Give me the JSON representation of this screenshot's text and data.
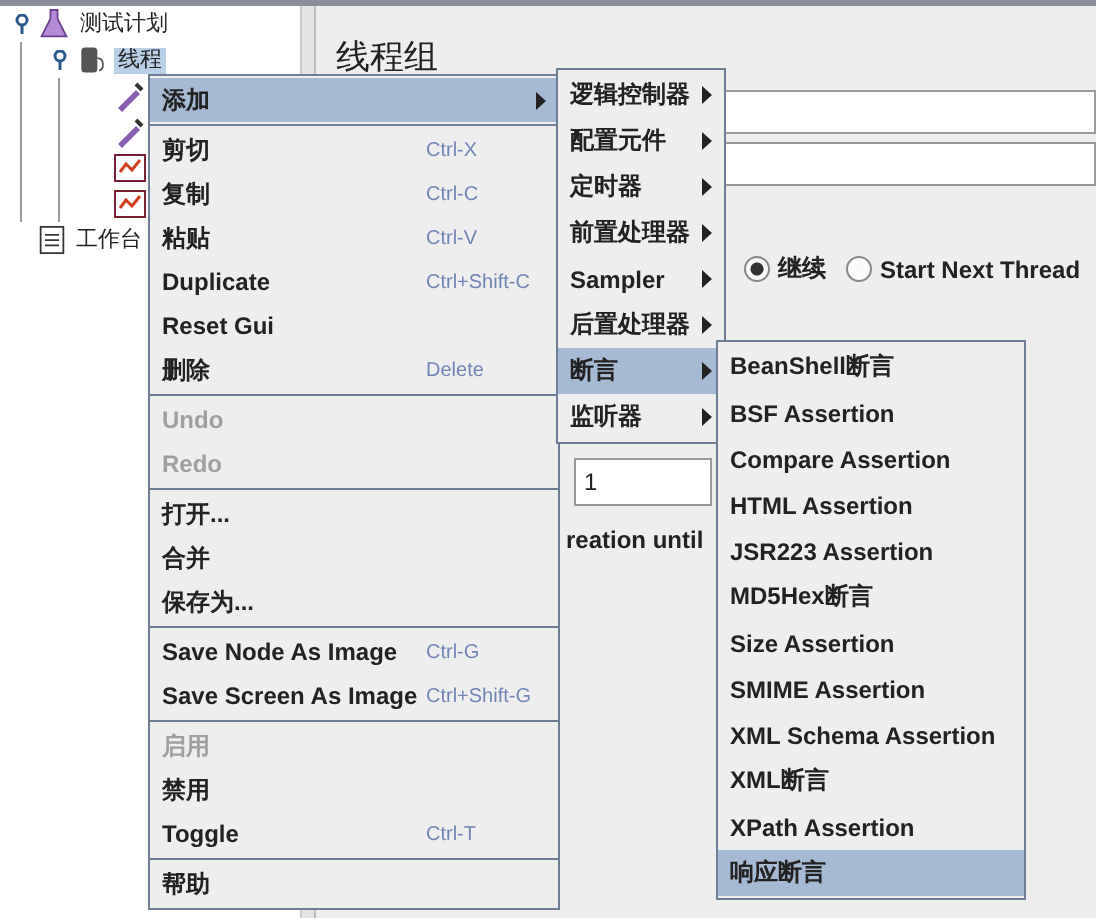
{
  "tree": [
    {
      "label": "测试计划",
      "kind": "plan",
      "selected": false,
      "expanded": true,
      "children": [
        {
          "label": "线程",
          "kind": "threads",
          "selected": true,
          "expanded": true,
          "children": [
            {
              "kind": "pipette"
            },
            {
              "kind": "pipette"
            },
            {
              "kind": "listener"
            },
            {
              "kind": "listener"
            }
          ]
        }
      ]
    },
    {
      "label": "工作台",
      "kind": "workbench",
      "selected": false
    }
  ],
  "panel": {
    "title": "线程组",
    "radios": [
      {
        "label": "继续",
        "selected": true
      },
      {
        "label": "Start Next Thread",
        "selected": false
      }
    ],
    "field_value": "1",
    "note": "reation until"
  },
  "menu": [
    {
      "kind": "item",
      "label": "添加",
      "submenu": true,
      "selected": true
    },
    {
      "kind": "separator"
    },
    {
      "kind": "item",
      "label": "剪切",
      "shortcut": "Ctrl-X"
    },
    {
      "kind": "item",
      "label": "复制",
      "shortcut": "Ctrl-C"
    },
    {
      "kind": "item",
      "label": "粘贴",
      "shortcut": "Ctrl-V"
    },
    {
      "kind": "item",
      "label": "Duplicate",
      "shortcut": "Ctrl+Shift-C"
    },
    {
      "kind": "item",
      "label": "Reset Gui"
    },
    {
      "kind": "item",
      "label": "删除",
      "shortcut": "Delete"
    },
    {
      "kind": "separator"
    },
    {
      "kind": "item",
      "label": "Undo",
      "disabled": true
    },
    {
      "kind": "item",
      "label": "Redo",
      "disabled": true
    },
    {
      "kind": "separator"
    },
    {
      "kind": "item",
      "label": "打开..."
    },
    {
      "kind": "item",
      "label": "合并"
    },
    {
      "kind": "item",
      "label": "保存为..."
    },
    {
      "kind": "separator"
    },
    {
      "kind": "item",
      "label": "Save Node As Image",
      "shortcut": "Ctrl-G"
    },
    {
      "kind": "item",
      "label": "Save Screen As Image",
      "shortcut": "Ctrl+Shift-G"
    },
    {
      "kind": "separator"
    },
    {
      "kind": "item",
      "label": "启用",
      "disabled": true
    },
    {
      "kind": "item",
      "label": "禁用"
    },
    {
      "kind": "item",
      "label": "Toggle",
      "shortcut": "Ctrl-T"
    },
    {
      "kind": "separator"
    },
    {
      "kind": "item",
      "label": "帮助"
    }
  ],
  "add_submenu": [
    {
      "label": "逻辑控制器",
      "selected": false
    },
    {
      "label": "配置元件",
      "selected": false
    },
    {
      "label": "定时器",
      "selected": false
    },
    {
      "label": "前置处理器",
      "selected": false
    },
    {
      "label": "Sampler",
      "selected": false
    },
    {
      "label": "后置处理器",
      "selected": false
    },
    {
      "label": "断言",
      "selected": true
    },
    {
      "label": "监听器",
      "selected": false
    }
  ],
  "assertion_submenu": [
    {
      "label": "BeanShell断言",
      "selected": false
    },
    {
      "label": "BSF Assertion",
      "selected": false
    },
    {
      "label": "Compare Assertion",
      "selected": false
    },
    {
      "label": "HTML Assertion",
      "selected": false
    },
    {
      "label": "JSR223 Assertion",
      "selected": false
    },
    {
      "label": "MD5Hex断言",
      "selected": false
    },
    {
      "label": "Size Assertion",
      "selected": false
    },
    {
      "label": "SMIME Assertion",
      "selected": false
    },
    {
      "label": "XML Schema Assertion",
      "selected": false
    },
    {
      "label": "XML断言",
      "selected": false
    },
    {
      "label": "XPath Assertion",
      "selected": false
    },
    {
      "label": "响应断言",
      "selected": true
    }
  ]
}
